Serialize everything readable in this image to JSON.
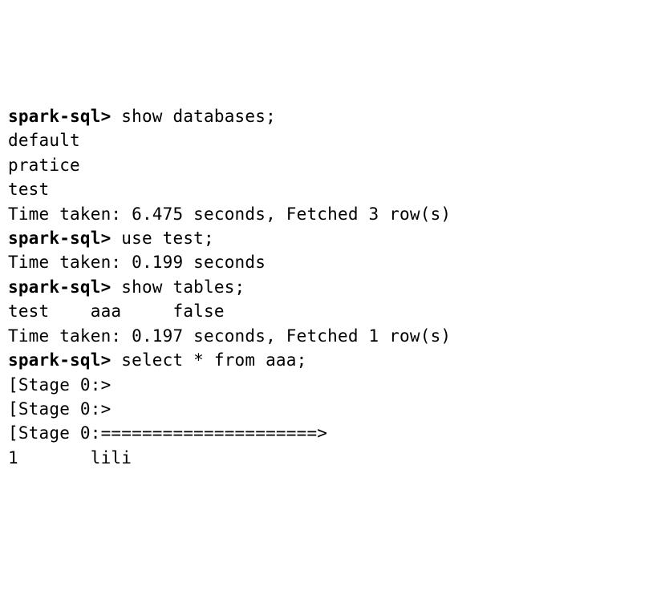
{
  "terminal": {
    "prompt": "spark-sql>",
    "entries": [
      {
        "type": "cmd",
        "command": "show databases;"
      },
      {
        "type": "out",
        "text": "default"
      },
      {
        "type": "out",
        "text": "pratice"
      },
      {
        "type": "out",
        "text": "test"
      },
      {
        "type": "out",
        "text": "Time taken: 6.475 seconds, Fetched 3 row(s)"
      },
      {
        "type": "cmd",
        "command": "use test;"
      },
      {
        "type": "out",
        "text": "Time taken: 0.199 seconds"
      },
      {
        "type": "cmd",
        "command": "show tables;"
      },
      {
        "type": "out",
        "text": "test    aaa     false"
      },
      {
        "type": "out",
        "text": "Time taken: 0.197 seconds, Fetched 1 row(s)"
      },
      {
        "type": "cmd",
        "command": "select * from aaa;"
      },
      {
        "type": "out",
        "text": "[Stage 0:>"
      },
      {
        "type": "out",
        "text": "[Stage 0:>"
      },
      {
        "type": "out",
        "text": "[Stage 0:=====================>"
      },
      {
        "type": "out",
        "text": ""
      },
      {
        "type": "out",
        "text": "1       lili"
      }
    ]
  }
}
